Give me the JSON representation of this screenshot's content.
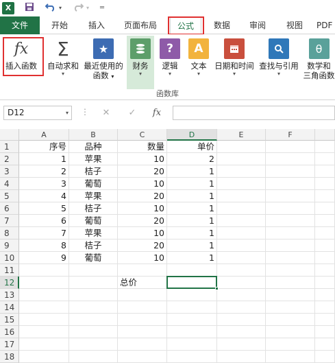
{
  "app": {
    "logo": "X"
  },
  "qat": {
    "save_icon": "save-icon",
    "undo_icon": "undo-icon",
    "redo_icon": "redo-icon",
    "customize_icon": "customize-icon"
  },
  "tabs": [
    "文件",
    "开始",
    "插入",
    "页面布局",
    "公式",
    "数据",
    "审阅",
    "视图",
    "PDF"
  ],
  "active_tab": "公式",
  "ribbon": {
    "buttons": [
      {
        "label": "插入函数",
        "icon": "fx-icon",
        "dropdown": false
      },
      {
        "label": "自动求和",
        "icon": "sigma-icon",
        "dropdown": true
      },
      {
        "label": "最近使用的",
        "label2": "函数",
        "icon": "star-book-icon",
        "dropdown": true
      },
      {
        "label": "财务",
        "icon": "coins-icon",
        "dropdown": true,
        "selected": true
      },
      {
        "label": "逻辑",
        "icon": "question-book-icon",
        "dropdown": true
      },
      {
        "label": "文本",
        "icon": "text-book-icon",
        "dropdown": true
      },
      {
        "label": "日期和时间",
        "icon": "calendar-book-icon",
        "dropdown": true
      },
      {
        "label": "查找与引用",
        "icon": "lookup-book-icon",
        "dropdown": true
      },
      {
        "label": "数学和",
        "label2": "三角函数",
        "icon": "theta-book-icon",
        "dropdown": true
      }
    ],
    "group_label": "函数库"
  },
  "formula_bar": {
    "name_box": "D12",
    "cancel_glyph": "✕",
    "confirm_glyph": "✓",
    "fx_glyph": "fx",
    "value": ""
  },
  "sheet": {
    "columns": [
      "A",
      "B",
      "C",
      "D",
      "E",
      "F"
    ],
    "selected_column": "D",
    "selected_row": "12",
    "rows": [
      {
        "n": "1",
        "A": "序号",
        "B": "品种",
        "C": "数量",
        "D": "单价"
      },
      {
        "n": "2",
        "A": "1",
        "B": "苹果",
        "C": "10",
        "D": "2"
      },
      {
        "n": "3",
        "A": "2",
        "B": "桔子",
        "C": "20",
        "D": "1"
      },
      {
        "n": "4",
        "A": "3",
        "B": "葡萄",
        "C": "10",
        "D": "1"
      },
      {
        "n": "5",
        "A": "4",
        "B": "苹果",
        "C": "20",
        "D": "1"
      },
      {
        "n": "6",
        "A": "5",
        "B": "桔子",
        "C": "10",
        "D": "1"
      },
      {
        "n": "7",
        "A": "6",
        "B": "葡萄",
        "C": "20",
        "D": "1"
      },
      {
        "n": "8",
        "A": "7",
        "B": "苹果",
        "C": "10",
        "D": "1"
      },
      {
        "n": "9",
        "A": "8",
        "B": "桔子",
        "C": "20",
        "D": "1"
      },
      {
        "n": "10",
        "A": "9",
        "B": "葡萄",
        "C": "10",
        "D": "1"
      },
      {
        "n": "11",
        "A": "",
        "B": "",
        "C": "",
        "D": ""
      },
      {
        "n": "12",
        "A": "",
        "B": "",
        "C": "总价",
        "D": ""
      },
      {
        "n": "13",
        "A": "",
        "B": "",
        "C": "",
        "D": ""
      },
      {
        "n": "14",
        "A": "",
        "B": "",
        "C": "",
        "D": ""
      },
      {
        "n": "15",
        "A": "",
        "B": "",
        "C": "",
        "D": ""
      },
      {
        "n": "16",
        "A": "",
        "B": "",
        "C": "",
        "D": ""
      },
      {
        "n": "17",
        "A": "",
        "B": "",
        "C": "",
        "D": ""
      },
      {
        "n": "18",
        "A": "",
        "B": "",
        "C": "",
        "D": ""
      }
    ]
  },
  "colors": {
    "excel_green": "#217346",
    "highlight_red": "#e03030"
  }
}
